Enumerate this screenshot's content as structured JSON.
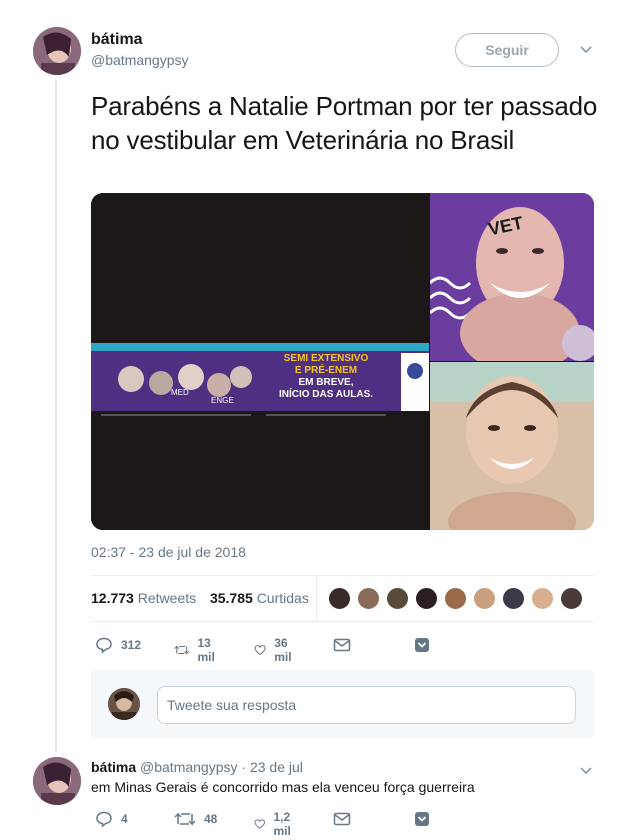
{
  "tweet": {
    "author_name": "bátima",
    "author_handle": "@batmangypsy",
    "follow_label": "Seguir",
    "text": "Parabéns a Natalie Portman por ter passado no vestibular em Veterinária no Brasil",
    "timestamp": "02:37 - 23 de jul de 2018",
    "media": {
      "banner_lines": [
        "SEMI EXTENSIVO",
        "E PRÉ-ENEM",
        "EM BREVE,",
        "INÍCIO DAS AULAS."
      ],
      "sign_text": "VET",
      "small_labels": [
        "MED",
        "ENGE"
      ]
    },
    "stats": {
      "retweets_count": "12.773",
      "retweets_label": "Retweets",
      "likes_count": "35.785",
      "likes_label": "Curtidas"
    },
    "likers": [
      "#3a2a2a",
      "#8a6a5a",
      "#5a4a3a",
      "#2a2020",
      "#9a6a4a",
      "#c8a080",
      "#3a3a4a",
      "#d8b090",
      "#4a3a3a"
    ],
    "actions": {
      "replies": "312",
      "retweets": "13 mil",
      "likes": "36 mil"
    }
  },
  "reply_box": {
    "placeholder": "Tweete sua resposta"
  },
  "reply": {
    "author_name": "bátima",
    "author_handle": "@batmangypsy",
    "time": "· 23 de jul",
    "text": "em Minas Gerais é concorrido mas ela venceu força guerreira",
    "actions": {
      "replies": "4",
      "retweets": "48",
      "likes": "1,2 mil"
    }
  },
  "colors": {
    "text": "#14171a",
    "secondary": "#657786",
    "border": "#e6ecf0",
    "accent": "#1da1f2"
  }
}
